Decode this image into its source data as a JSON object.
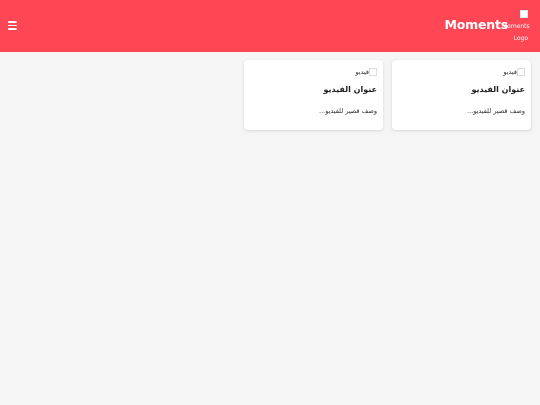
{
  "header": {
    "brand": "Moments",
    "logo_alt": "Moments Logo",
    "menu_icon": "hamburger-menu-icon",
    "background": "#ff4655"
  },
  "cards": [
    {
      "thumbnail_alt": "فيديو",
      "title": "عنوان الفيديو",
      "description": "وصف قصير للفيديو..."
    },
    {
      "thumbnail_alt": "فيديو",
      "title": "عنوان الفيديو",
      "description": "وصف قصير للفيديو..."
    }
  ]
}
